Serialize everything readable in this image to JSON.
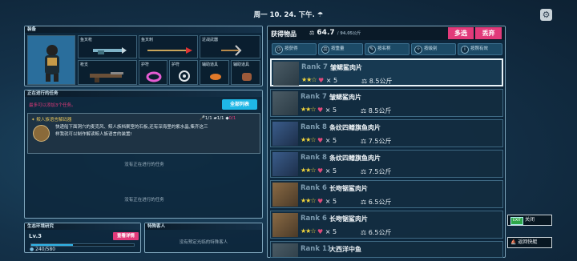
{
  "topbar": {
    "date": "周一 10. 24. 下午."
  },
  "equipment": {
    "title": "装备",
    "slots": [
      {
        "label": "鱼叉枪",
        "icon": "harpoon-gun-icon"
      },
      {
        "label": "鱼叉刺",
        "icon": "harpoon-spear-icon"
      },
      {
        "label": "近战武器",
        "icon": "pickaxe-icon"
      },
      {
        "label": "枪支",
        "icon": "rifle-icon"
      },
      {
        "label": "护符",
        "icon": "ring-icon"
      },
      {
        "label": "护符",
        "icon": "snail-charm-icon"
      },
      {
        "label": "辅助道具",
        "icon": "crab-item-icon"
      },
      {
        "label": "辅助道具",
        "icon": "pot-item-icon"
      }
    ]
  },
  "tasks": {
    "title": "正在进行的任务",
    "subtitle": "最多可以添加3个任务。",
    "all_button": "全部列表",
    "active": {
      "name": "鲛人族语言解码器",
      "req1": "1/1",
      "req2": "1/1",
      "req3": "0/1",
      "desc_line1": "快递船下面洞穴的麦克风、鲛人族档案室的石板,还有深海里的紫水晶,集齐这三",
      "desc_line2": "样我就可以制作解读鲛人族语言的装置!"
    },
    "empty1": "没有正在进行的任务",
    "empty2": "没有正在进行的任务"
  },
  "ecology": {
    "title": "生态环境研究",
    "level": "Lv.3",
    "detail_button": "查看详情",
    "progress": "240/580",
    "progress_fraction": 0.41
  },
  "guest": {
    "title": "特殊客人",
    "empty": "没有预定光临的特殊客人"
  },
  "loot": {
    "title": "获得物品",
    "capacity": "64.7",
    "capacity_max": "/ 94.05公斤",
    "multi_button": "多选",
    "discard_button": "丢弃",
    "tabs": [
      "按获得",
      "按重量",
      "按名称",
      "按级别",
      "按照有效"
    ],
    "items": [
      {
        "rank": "Rank 7",
        "name": "皱鳃鲨肉片",
        "stars": "★★☆",
        "qty": "5",
        "weight": "8.5公斤"
      },
      {
        "rank": "Rank 7",
        "name": "皱鳃鲨肉片",
        "stars": "★★☆",
        "qty": "5",
        "weight": "8.5公斤"
      },
      {
        "rank": "Rank 8",
        "name": "条纹四鳍旗鱼肉片",
        "stars": "★★☆",
        "qty": "5",
        "weight": "7.5公斤"
      },
      {
        "rank": "Rank 8",
        "name": "条纹四鳍旗鱼肉片",
        "stars": "★★☆",
        "qty": "5",
        "weight": "7.5公斤"
      },
      {
        "rank": "Rank 6",
        "name": "长吻锯鲨肉片",
        "stars": "★★☆",
        "qty": "5",
        "weight": "6.5公斤"
      },
      {
        "rank": "Rank 6",
        "name": "长吻锯鲨肉片",
        "stars": "★★☆",
        "qty": "5",
        "weight": "6.5公斤"
      },
      {
        "rank": "Rank 11",
        "name": "大西洋中鱼",
        "stars": "",
        "qty": "",
        "weight": ""
      }
    ]
  },
  "side": {
    "close_key": "EXIT",
    "close_label": "关闭",
    "return_label": "返回快艇"
  },
  "colors": {
    "accent": "#1fb7e6",
    "pink": "#e23a7a",
    "star": "#f2d53c"
  }
}
